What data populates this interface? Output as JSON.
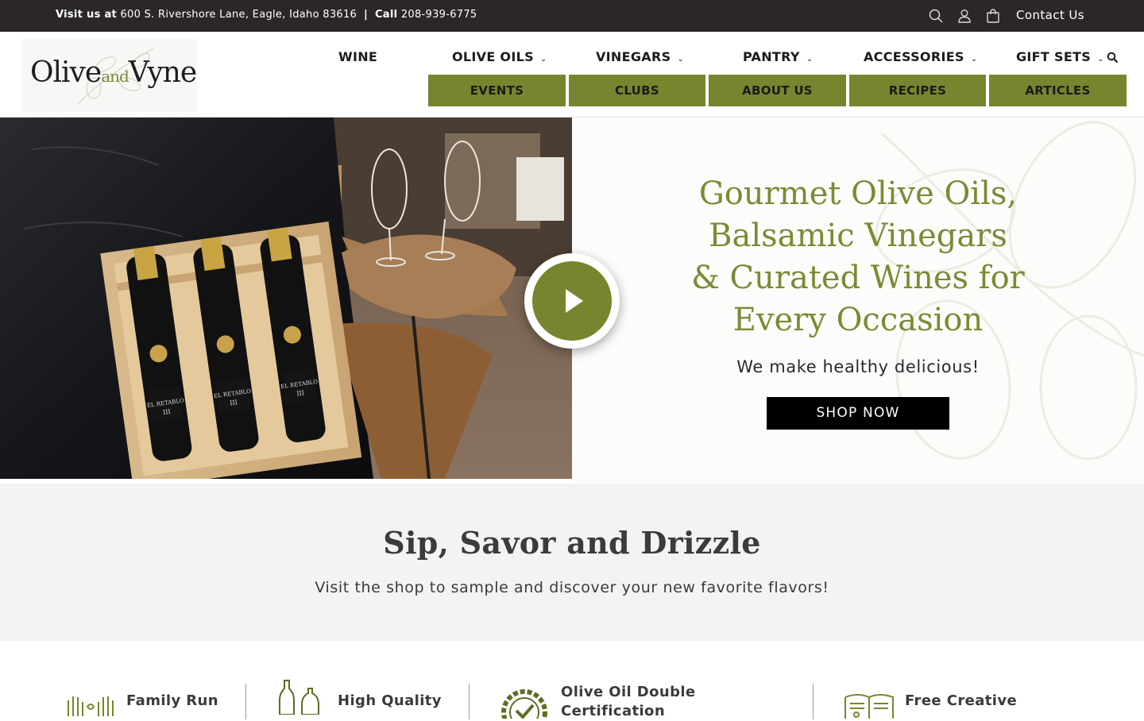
{
  "topbar": {
    "visit_label": "Visit us at",
    "address": "600 S. Rivershore Lane, Eagle, Idaho 83616",
    "separator": "|",
    "call_label": "Call",
    "phone": "208-939-6775",
    "contact": "Contact Us",
    "icons": [
      "search-icon",
      "account-icon",
      "cart-icon"
    ]
  },
  "logo": {
    "part1": "Olive",
    "part2": "and",
    "part3": "Vyne"
  },
  "nav": {
    "items": [
      {
        "label": "WINE",
        "chevron": false
      },
      {
        "label": "OLIVE OILS",
        "chevron": true
      },
      {
        "label": "VINEGARS",
        "chevron": true
      },
      {
        "label": "PANTRY",
        "chevron": true
      },
      {
        "label": "ACCESSORIES",
        "chevron": true
      },
      {
        "label": "GIFT SETS",
        "chevron": true
      }
    ],
    "chevron_glyph": "⌄",
    "sub_items": [
      "EVENTS",
      "CLUBS",
      "ABOUT US",
      "RECIPES",
      "ARTICLES"
    ]
  },
  "hero": {
    "headline": "Gourmet Olive Oils, Balsamic Vinegars & Curated Wines for Every Occasion",
    "tagline": "We make healthy delicious!",
    "cta": "SHOP NOW",
    "bottle_label": "EL RETABLO",
    "bottle_num": "III"
  },
  "sip": {
    "title": "Sip, Savor and Drizzle",
    "subtitle": "Visit the shop to sample and discover your new favorite flavors!"
  },
  "features": [
    {
      "label": "Family Run",
      "icon": "hands-icon"
    },
    {
      "label": "High Quality",
      "icon": "bottles-icon"
    },
    {
      "label": "Olive Oil Double Certification",
      "icon": "certified-badge-icon"
    },
    {
      "label": "Free Creative",
      "icon": "recipe-book-icon"
    }
  ],
  "colors": {
    "accent": "#76862e",
    "topbar": "#2b2727",
    "headline": "#7a8b34"
  }
}
